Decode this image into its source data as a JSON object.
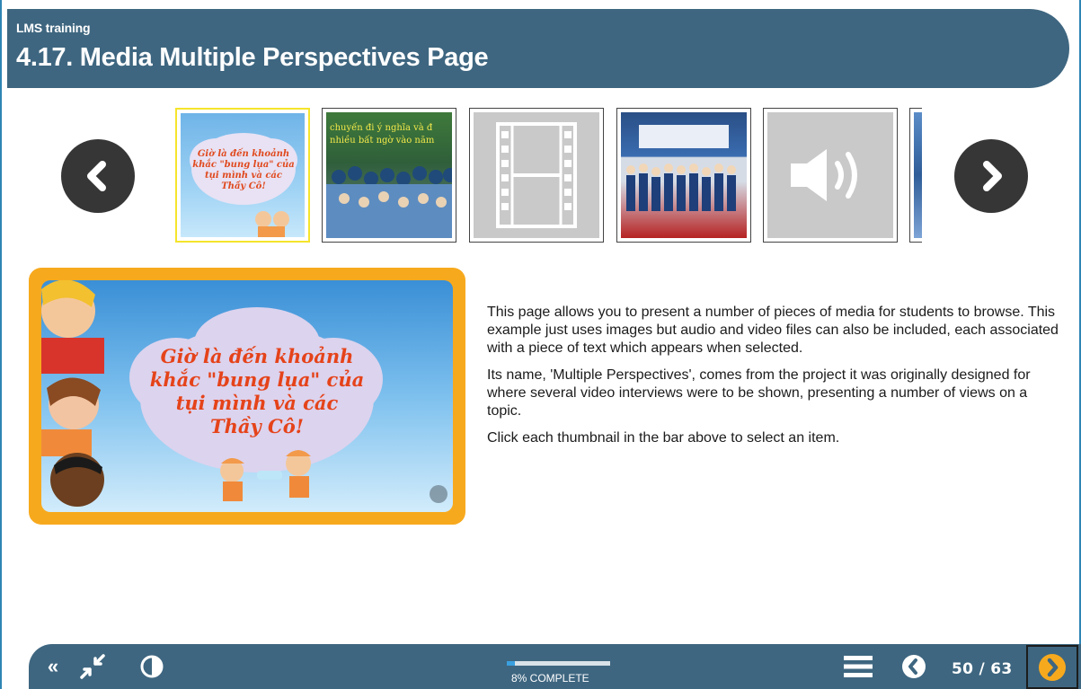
{
  "header": {
    "course": "LMS training",
    "title": "4.17. Media Multiple Perspectives Page"
  },
  "strip": {
    "prev_icon": "chevron-left-icon",
    "next_icon": "chevron-right-icon",
    "thumbnails": [
      {
        "kind": "image",
        "caption": "Giờ là đến khoảnh khắc \"bung lụa\" của tụi mình và các Thầy Cô!"
      },
      {
        "kind": "image",
        "caption": "chuyến đi ý nghĩa và đ... nhiều bất ngờ vào năm"
      },
      {
        "kind": "video",
        "icon": "film-icon"
      },
      {
        "kind": "image"
      },
      {
        "kind": "audio",
        "icon": "speaker-icon"
      },
      {
        "kind": "image"
      }
    ]
  },
  "media": {
    "caption_lines": [
      "Giờ là đến khoảnh",
      "khắc \"bung lụa\" của",
      "tụi mình và các",
      "Thầy Cô!"
    ]
  },
  "description": {
    "paragraphs": [
      "This page allows you to present a number of pieces of media for students to browse. This example just uses images but audio and video files can also be included, each associated with a piece of text which appears when selected.",
      "Its name, 'Multiple Perspectives', comes from the project it was originally designed for where several video interviews were to be shown, presenting a number of views on a topic.",
      "Click each thumbnail in the bar above to select an item."
    ]
  },
  "footer": {
    "collapse_label": "«",
    "progress_percent": 8,
    "progress_label": "8% COMPLETE",
    "page_count": "50 / 63",
    "colors": {
      "bar": "#3e6680",
      "next_accent": "#f7a91d",
      "progress": "#3aa0e0"
    }
  }
}
